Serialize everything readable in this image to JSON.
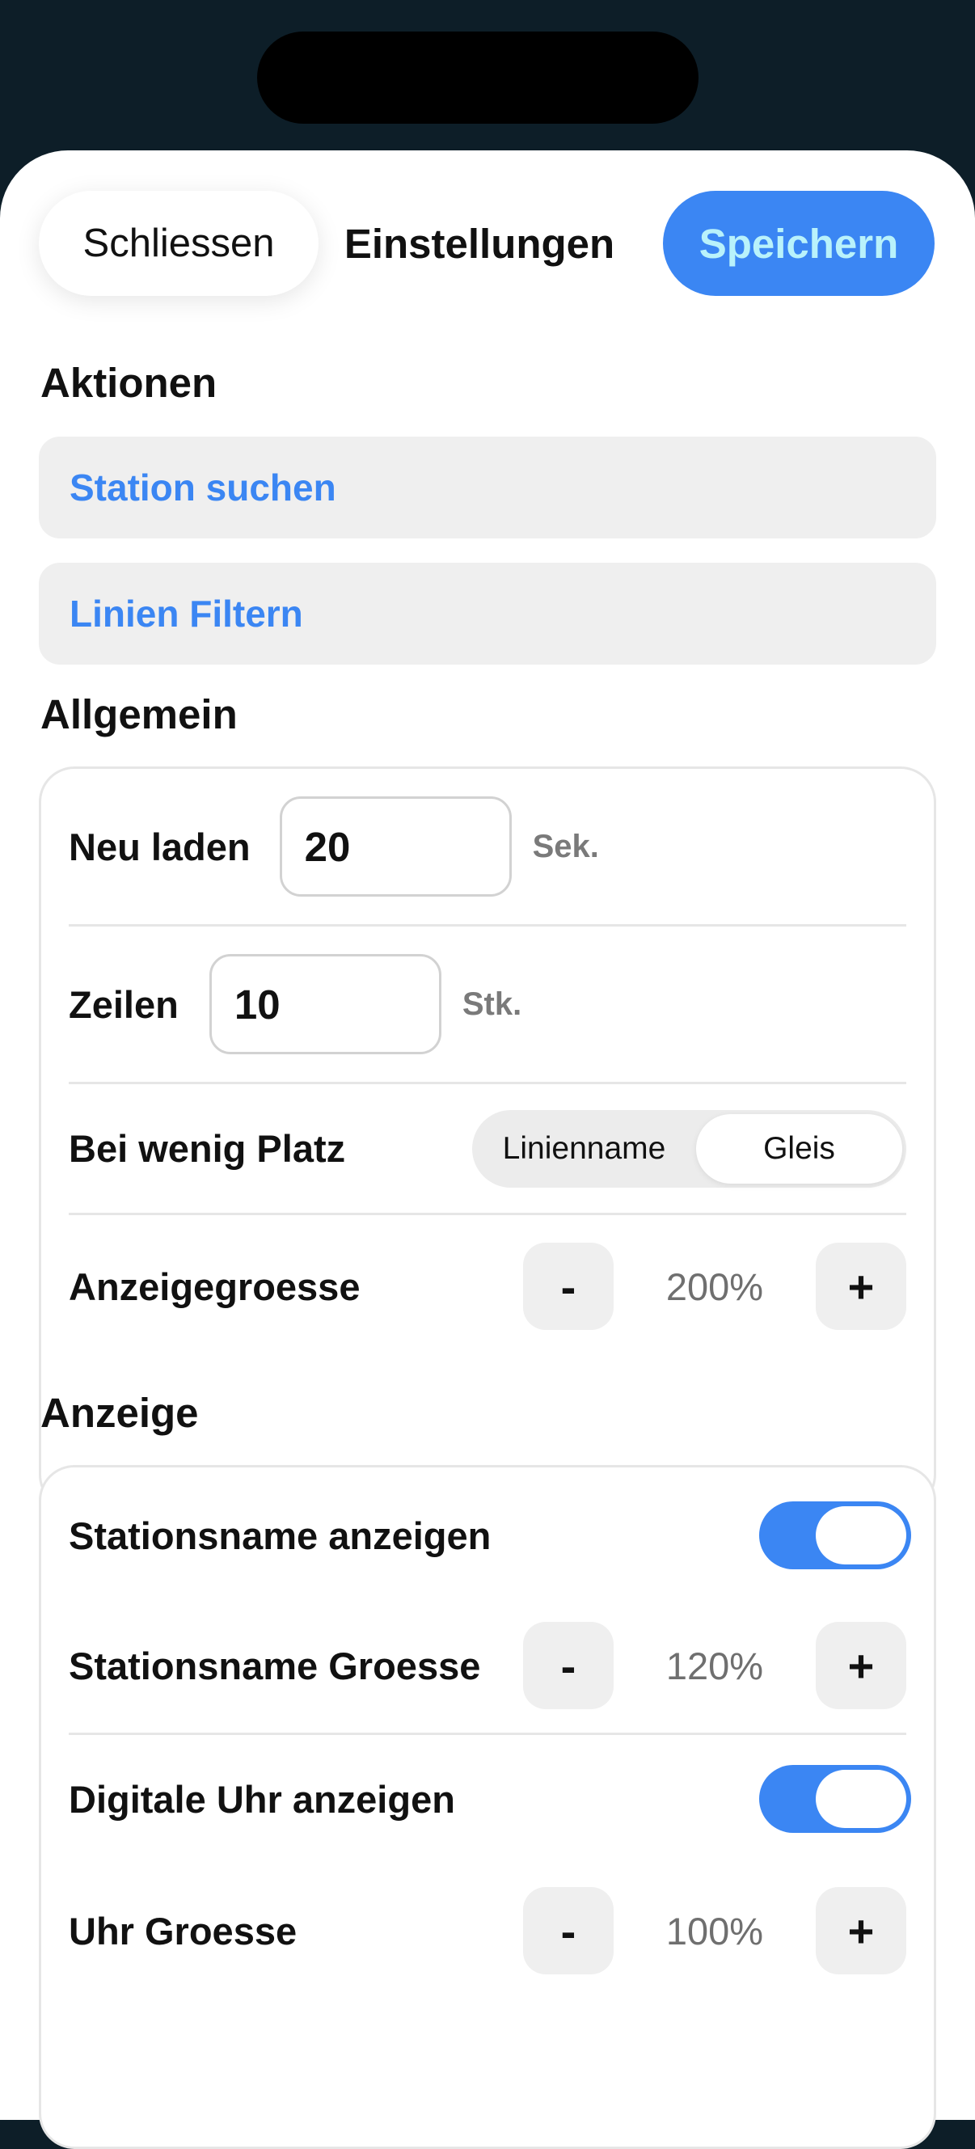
{
  "header": {
    "close_label": "Schliessen",
    "title": "Einstellungen",
    "save_label": "Speichern"
  },
  "sections": {
    "actions": {
      "title": "Aktionen",
      "items": [
        "Station suchen",
        "Linien Filtern"
      ]
    },
    "general": {
      "title": "Allgemein",
      "refresh": {
        "label": "Neu laden",
        "value": "20",
        "unit": "Sek."
      },
      "rows": {
        "label": "Zeilen",
        "value": "10",
        "unit": "Stk."
      },
      "low_space": {
        "label": "Bei wenig Platz",
        "options": [
          "Linienname",
          "Gleis"
        ],
        "selected": "Gleis"
      },
      "display_size": {
        "label": "Anzeigegroesse",
        "minus": "-",
        "value": "200%",
        "plus": "+"
      }
    },
    "display": {
      "title": "Anzeige",
      "show_station": {
        "label": "Stationsname anzeigen",
        "on": true
      },
      "station_size": {
        "label": "Stationsname Groesse",
        "minus": "-",
        "value": "120%",
        "plus": "+"
      },
      "show_clock": {
        "label": "Digitale Uhr anzeigen",
        "on": true
      },
      "clock_size": {
        "label": "Uhr Groesse",
        "minus": "-",
        "value": "100%",
        "plus": "+"
      }
    }
  },
  "colors": {
    "accent": "#3b86f3",
    "save_text": "#b9f2fb",
    "background_dark": "#0d1e28"
  }
}
